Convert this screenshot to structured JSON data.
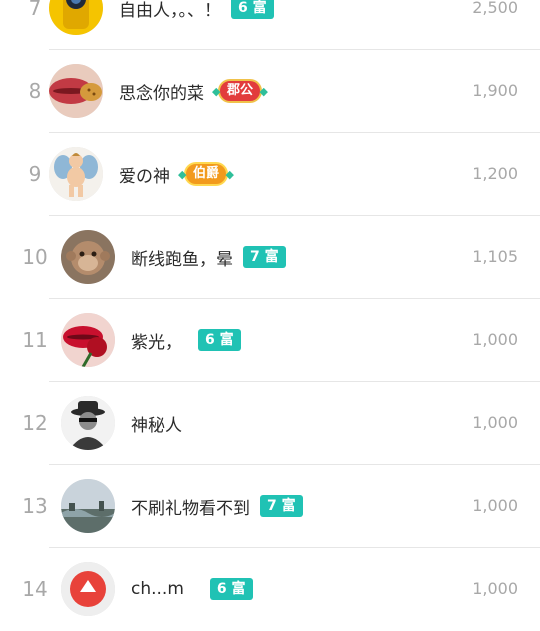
{
  "rows": [
    {
      "rank": "7",
      "name": "自由人，。、！",
      "badge_fortune": "6 富",
      "score": "2,500",
      "avatar": "yellow-camera-avatar"
    },
    {
      "rank": "8",
      "name": "思念你的菜",
      "badge_title": "郡公",
      "score": "1,900",
      "avatar": "lips-cookie-avatar"
    },
    {
      "rank": "9",
      "name": "爱の神",
      "badge_title": "伯爵",
      "score": "1,200",
      "avatar": "cupid-avatar"
    },
    {
      "rank": "10",
      "name": "断线跑鱼，晕",
      "badge_fortune": "7 富",
      "score": "1,105",
      "avatar": "monkey-avatar"
    },
    {
      "rank": "11",
      "name": "紫光，",
      "badge_fortune": "6 富",
      "score": "1,000",
      "avatar": "lips-rose-avatar"
    },
    {
      "rank": "12",
      "name": "神秘人",
      "score": "1,000",
      "avatar": "mystery-man-avatar"
    },
    {
      "rank": "13",
      "name": "不刷礼物看不到",
      "badge_fortune": "7 富",
      "score": "1,000",
      "avatar": "landscape-avatar"
    },
    {
      "rank": "14",
      "name": "ch...m",
      "badge_fortune": "6 富",
      "score": "1,000",
      "avatar": "red-app-avatar"
    }
  ]
}
